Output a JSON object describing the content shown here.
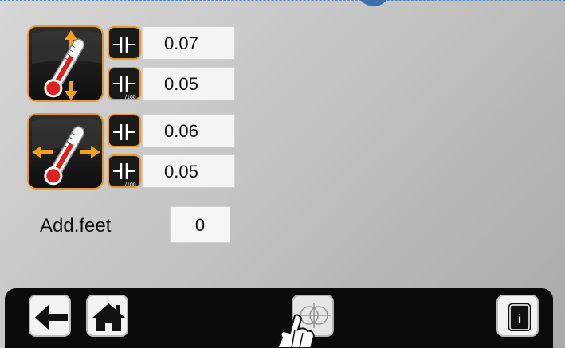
{
  "vertical": {
    "value_1": "0.07",
    "value_2": "0.05",
    "icon": "thermometer-vertical-icon"
  },
  "horizontal": {
    "value_1": "0.06",
    "value_2": "0.05",
    "icon": "thermometer-horizontal-icon"
  },
  "precision_label": "/100",
  "add_feet": {
    "label": "Add.feet",
    "value": "0"
  },
  "toolbar": {
    "back_icon": "arrow-left-icon",
    "home_icon": "home-icon",
    "measure_icon": "crosshair-touch-icon",
    "info_icon": "info-icon"
  },
  "info_letter": "i",
  "colors": {
    "accent": "#e39a2a",
    "thermo_red": "#e02020",
    "toolbar_bg": "#0b0b0b"
  }
}
